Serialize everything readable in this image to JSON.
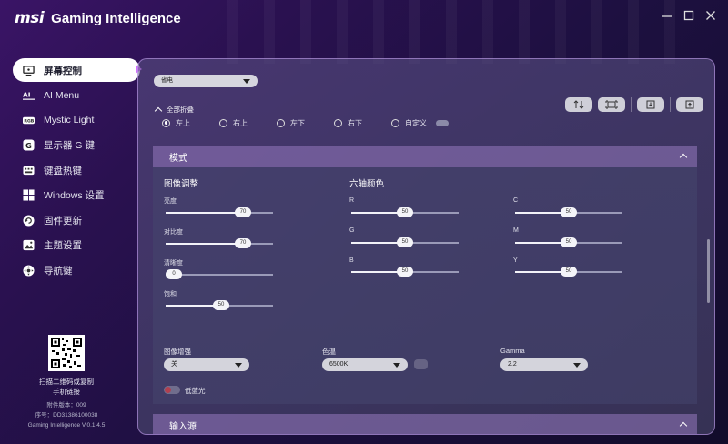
{
  "app": {
    "brand": "msi",
    "title": "Gaming Intelligence",
    "window_buttons": [
      "minimize-icon",
      "maximize-icon",
      "close-icon"
    ]
  },
  "sidebar": {
    "items": [
      {
        "label": "屏幕控制",
        "icon": "monitor-icon",
        "active": true
      },
      {
        "label": "AI Menu",
        "icon": "ai-icon"
      },
      {
        "label": "Mystic Light",
        "icon": "rgb-icon"
      },
      {
        "label": "显示器 G 键",
        "icon": "g-key-icon"
      },
      {
        "label": "键盘热键",
        "icon": "keyboard-icon"
      },
      {
        "label": "Windows 设置",
        "icon": "windows-icon"
      },
      {
        "label": "固件更新",
        "icon": "firmware-update-icon"
      },
      {
        "label": "主题设置",
        "icon": "theme-icon"
      },
      {
        "label": "导航键",
        "icon": "navigation-icon"
      }
    ],
    "footer": {
      "scan_line1": "扫描二维码或复制",
      "scan_line2": "手机链接",
      "firmware": "附件版本：009",
      "serial": "序号：DD31386100038",
      "version": "Gaming Intelligence V.0.1.4.5"
    }
  },
  "main": {
    "preset_value": "省电",
    "collapse_all": "全部折叠",
    "tools": [
      "sort-icon",
      "screen-icon",
      "download-icon",
      "export-icon"
    ],
    "positions": [
      {
        "label": "左上",
        "checked": true
      },
      {
        "label": "右上",
        "checked": false
      },
      {
        "label": "左下",
        "checked": false
      },
      {
        "label": "右下",
        "checked": false
      },
      {
        "label": "自定义",
        "checked": false
      }
    ],
    "mode_section": {
      "title": "模式",
      "image_adjust": {
        "title": "图像调整",
        "sliders": [
          {
            "label": "亮度",
            "value": "70",
            "fraction": 0.7
          },
          {
            "label": "对比度",
            "value": "70",
            "fraction": 0.7
          },
          {
            "label": "清晰度",
            "value": "0",
            "fraction": 0.0
          },
          {
            "label": "饱和",
            "value": "50",
            "fraction": 0.5
          }
        ]
      },
      "six_axis": {
        "title": "六轴颜色",
        "sliders": [
          {
            "label": "R",
            "value": "50",
            "fraction": 0.5
          },
          {
            "label": "G",
            "value": "50",
            "fraction": 0.5
          },
          {
            "label": "B",
            "value": "50",
            "fraction": 0.5
          },
          {
            "label": "C",
            "value": "50",
            "fraction": 0.5
          },
          {
            "label": "M",
            "value": "50",
            "fraction": 0.5
          },
          {
            "label": "Y",
            "value": "50",
            "fraction": 0.5
          }
        ]
      },
      "image_enhance": {
        "label": "图像增强",
        "value": "关"
      },
      "color_temp": {
        "label": "色温",
        "value": "6500K"
      },
      "gamma": {
        "label": "Gamma",
        "value": "2.2"
      },
      "low_blue": {
        "label": "低蓝光",
        "on": false
      }
    },
    "input_section": {
      "title": "输入源"
    }
  }
}
